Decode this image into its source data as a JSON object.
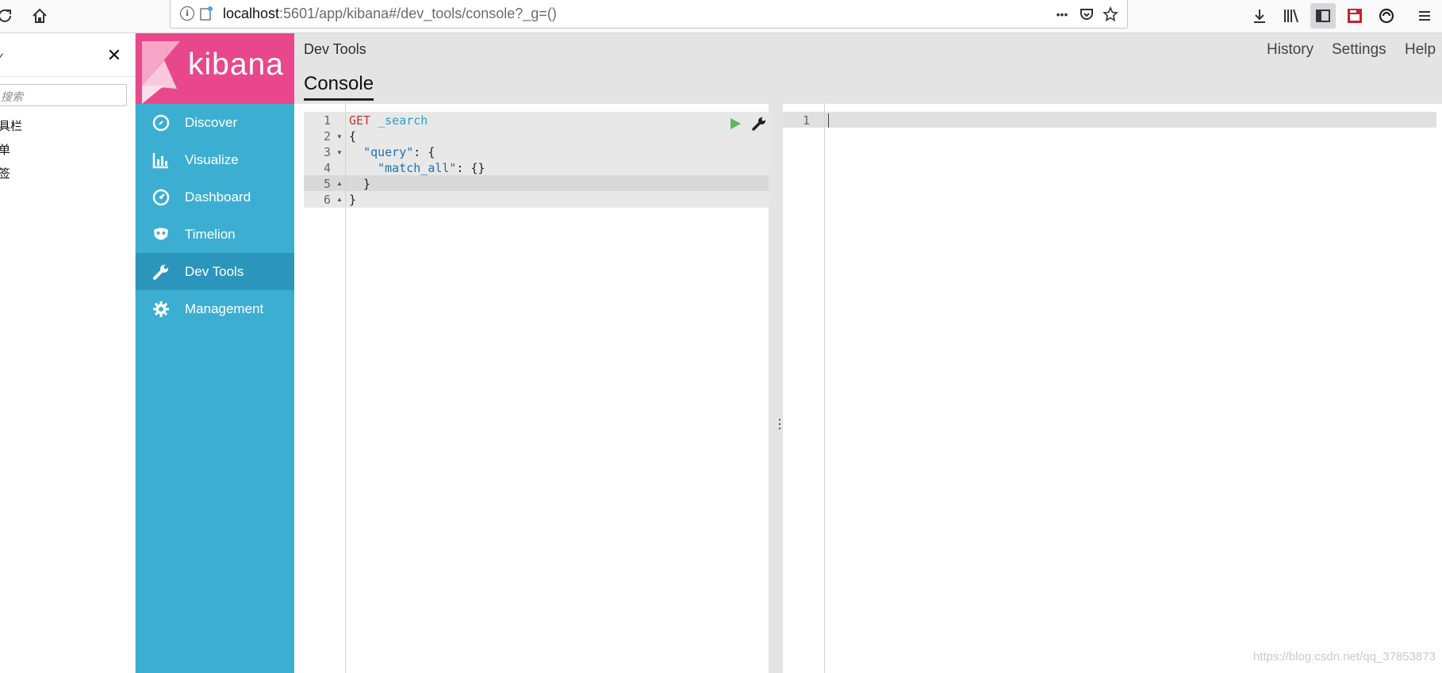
{
  "browser": {
    "url_host": "localhost",
    "url_rest": ":5601/app/kibana#/dev_tools/console?_g=()",
    "menu_dots": "•••"
  },
  "ext_sidebar": {
    "close_glyph": "✕",
    "caret_glyph": "✓",
    "search_placeholder": "搜索",
    "items": [
      "具栏",
      "单",
      "签"
    ]
  },
  "kibana": {
    "logo_text": "kibana",
    "nav": [
      {
        "label": "Discover",
        "icon": "compass-icon"
      },
      {
        "label": "Visualize",
        "icon": "bar-chart-icon"
      },
      {
        "label": "Dashboard",
        "icon": "gauge-icon"
      },
      {
        "label": "Timelion",
        "icon": "mask-icon"
      },
      {
        "label": "Dev Tools",
        "icon": "wrench-icon",
        "active": true
      },
      {
        "label": "Management",
        "icon": "gear-icon"
      }
    ]
  },
  "header": {
    "app_title": "Dev Tools",
    "links": [
      "History",
      "Settings",
      "Help"
    ],
    "tab": "Console"
  },
  "editor": {
    "line_numbers": [
      "1",
      "2",
      "3",
      "4",
      "5",
      "6"
    ],
    "method": "GET",
    "path": "_search",
    "lines": {
      "l2": "{",
      "l3_key": "\"query\"",
      "l3_rest": ": {",
      "l4_key": "\"match_all\"",
      "l4_rest": ": {}",
      "l5": "  }",
      "l6": "}"
    }
  },
  "output": {
    "line_numbers": [
      "1"
    ]
  },
  "watermark": "https://blog.csdn.net/qq_37853873",
  "colors": {
    "logo_pink": "#e8488b",
    "nav_blue": "#3caed2",
    "nav_active": "#2c95bb",
    "run_green": "#5cb85c"
  }
}
